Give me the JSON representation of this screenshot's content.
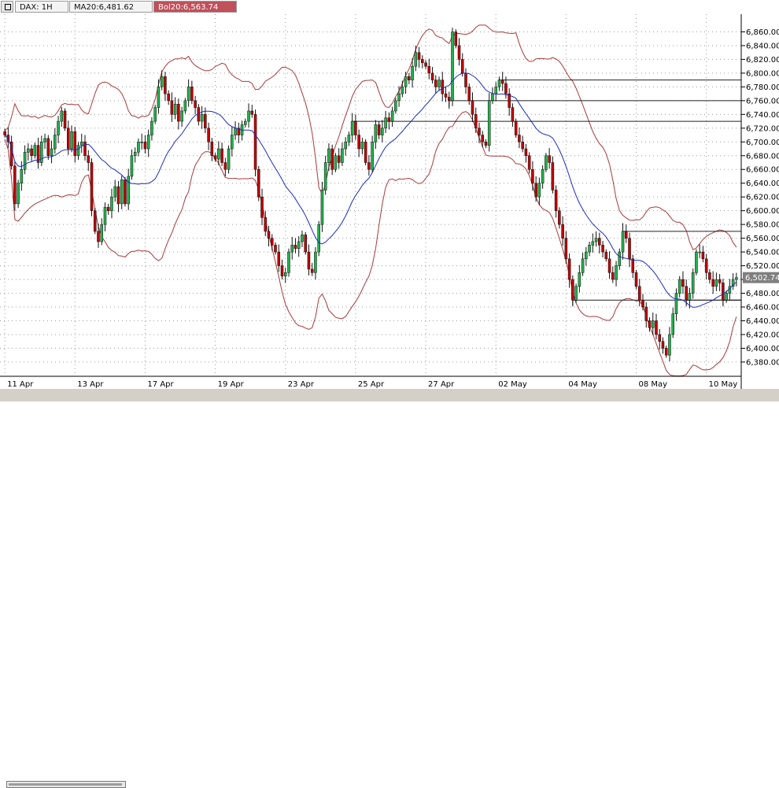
{
  "header": {
    "symbol": "DAX: 1H",
    "ma_label": "MA20:6,481.62",
    "bol_label": "Bol20:6,563.74"
  },
  "colors": {
    "up": "#22b14c",
    "down": "#c00000",
    "ma": "#1a2dbf",
    "band": "#a83a3a",
    "grid": "#9a9a9a",
    "level": "#222222",
    "last_price_box": "#7f7f7f"
  },
  "chart_data": {
    "type": "candlestick",
    "x_tick_labels": [
      "11 Apr",
      "13 Apr",
      "17 Apr",
      "19 Apr",
      "23 Apr",
      "25 Apr",
      "27 Apr",
      "02 May",
      "04 May",
      "08 May",
      "10 May"
    ],
    "y_ticks": [
      6380,
      6400,
      6420,
      6440,
      6460,
      6480,
      6500,
      6520,
      6540,
      6560,
      6580,
      6600,
      6620,
      6640,
      6660,
      6680,
      6700,
      6720,
      6740,
      6760,
      6780,
      6800,
      6820,
      6840,
      6860
    ],
    "y_tick_labels": [
      "6,380.00",
      "6,400.00",
      "6,420.00",
      "6,440.00",
      "6,460.00",
      "6,480.00",
      "6,500.00",
      "6,520.00",
      "6,540.00",
      "6,560.00",
      "6,580.00",
      "6,600.00",
      "6,620.00",
      "6,640.00",
      "6,660.00",
      "6,680.00",
      "6,700.00",
      "6,720.00",
      "6,740.00",
      "6,760.00",
      "6,780.00",
      "6,800.00",
      "6,820.00",
      "6,840.00",
      "6,860.00"
    ],
    "ylim": [
      6365,
      6880
    ],
    "grid": true,
    "last_price": 6502.74,
    "last_price_label": "6,502.74",
    "closes": [
      6710,
      6700,
      6665,
      6610,
      6640,
      6660,
      6685,
      6690,
      6680,
      6695,
      6670,
      6700,
      6705,
      6680,
      6690,
      6710,
      6730,
      6745,
      6720,
      6690,
      6715,
      6680,
      6695,
      6700,
      6680,
      6670,
      6600,
      6570,
      6555,
      6580,
      6605,
      6600,
      6620,
      6635,
      6610,
      6645,
      6610,
      6650,
      6680,
      6685,
      6700,
      6700,
      6690,
      6710,
      6730,
      6750,
      6780,
      6795,
      6770,
      6760,
      6740,
      6755,
      6730,
      6745,
      6760,
      6780,
      6760,
      6750,
      6730,
      6740,
      6720,
      6700,
      6680,
      6675,
      6690,
      6670,
      6660,
      6690,
      6710,
      6720,
      6710,
      6725,
      6730,
      6745,
      6740,
      6660,
      6620,
      6590,
      6570,
      6560,
      6550,
      6540,
      6520,
      6505,
      6510,
      6540,
      6550,
      6545,
      6555,
      6565,
      6540,
      6515,
      6510,
      6540,
      6580,
      6630,
      6670,
      6690,
      6660,
      6680,
      6670,
      6690,
      6700,
      6710,
      6730,
      6710,
      6690,
      6700,
      6670,
      6660,
      6700,
      6725,
      6710,
      6720,
      6735,
      6730,
      6745,
      6760,
      6770,
      6780,
      6795,
      6790,
      6810,
      6830,
      6820,
      6815,
      6810,
      6800,
      6790,
      6780,
      6790,
      6770,
      6765,
      6760,
      6860,
      6840,
      6820,
      6800,
      6780,
      6760,
      6740,
      6720,
      6710,
      6700,
      6695,
      6760,
      6770,
      6780,
      6790,
      6785,
      6770,
      6750,
      6730,
      6710,
      6700,
      6690,
      6680,
      6660,
      6640,
      6620,
      6640,
      6660,
      6680,
      6670,
      6630,
      6600,
      6580,
      6560,
      6530,
      6500,
      6470,
      6490,
      6510,
      6530,
      6540,
      6550,
      6555,
      6560,
      6550,
      6540,
      6530,
      6510,
      6500,
      6520,
      6540,
      6570,
      6560,
      6530,
      6510,
      6490,
      6470,
      6460,
      6440,
      6430,
      6440,
      6420,
      6410,
      6400,
      6390,
      6420,
      6450,
      6480,
      6500,
      6490,
      6470,
      6480,
      6510,
      6540,
      6540,
      6530,
      6510,
      6500,
      6490,
      6500,
      6495,
      6470,
      6480,
      6490,
      6500,
      6502.74
    ]
  }
}
